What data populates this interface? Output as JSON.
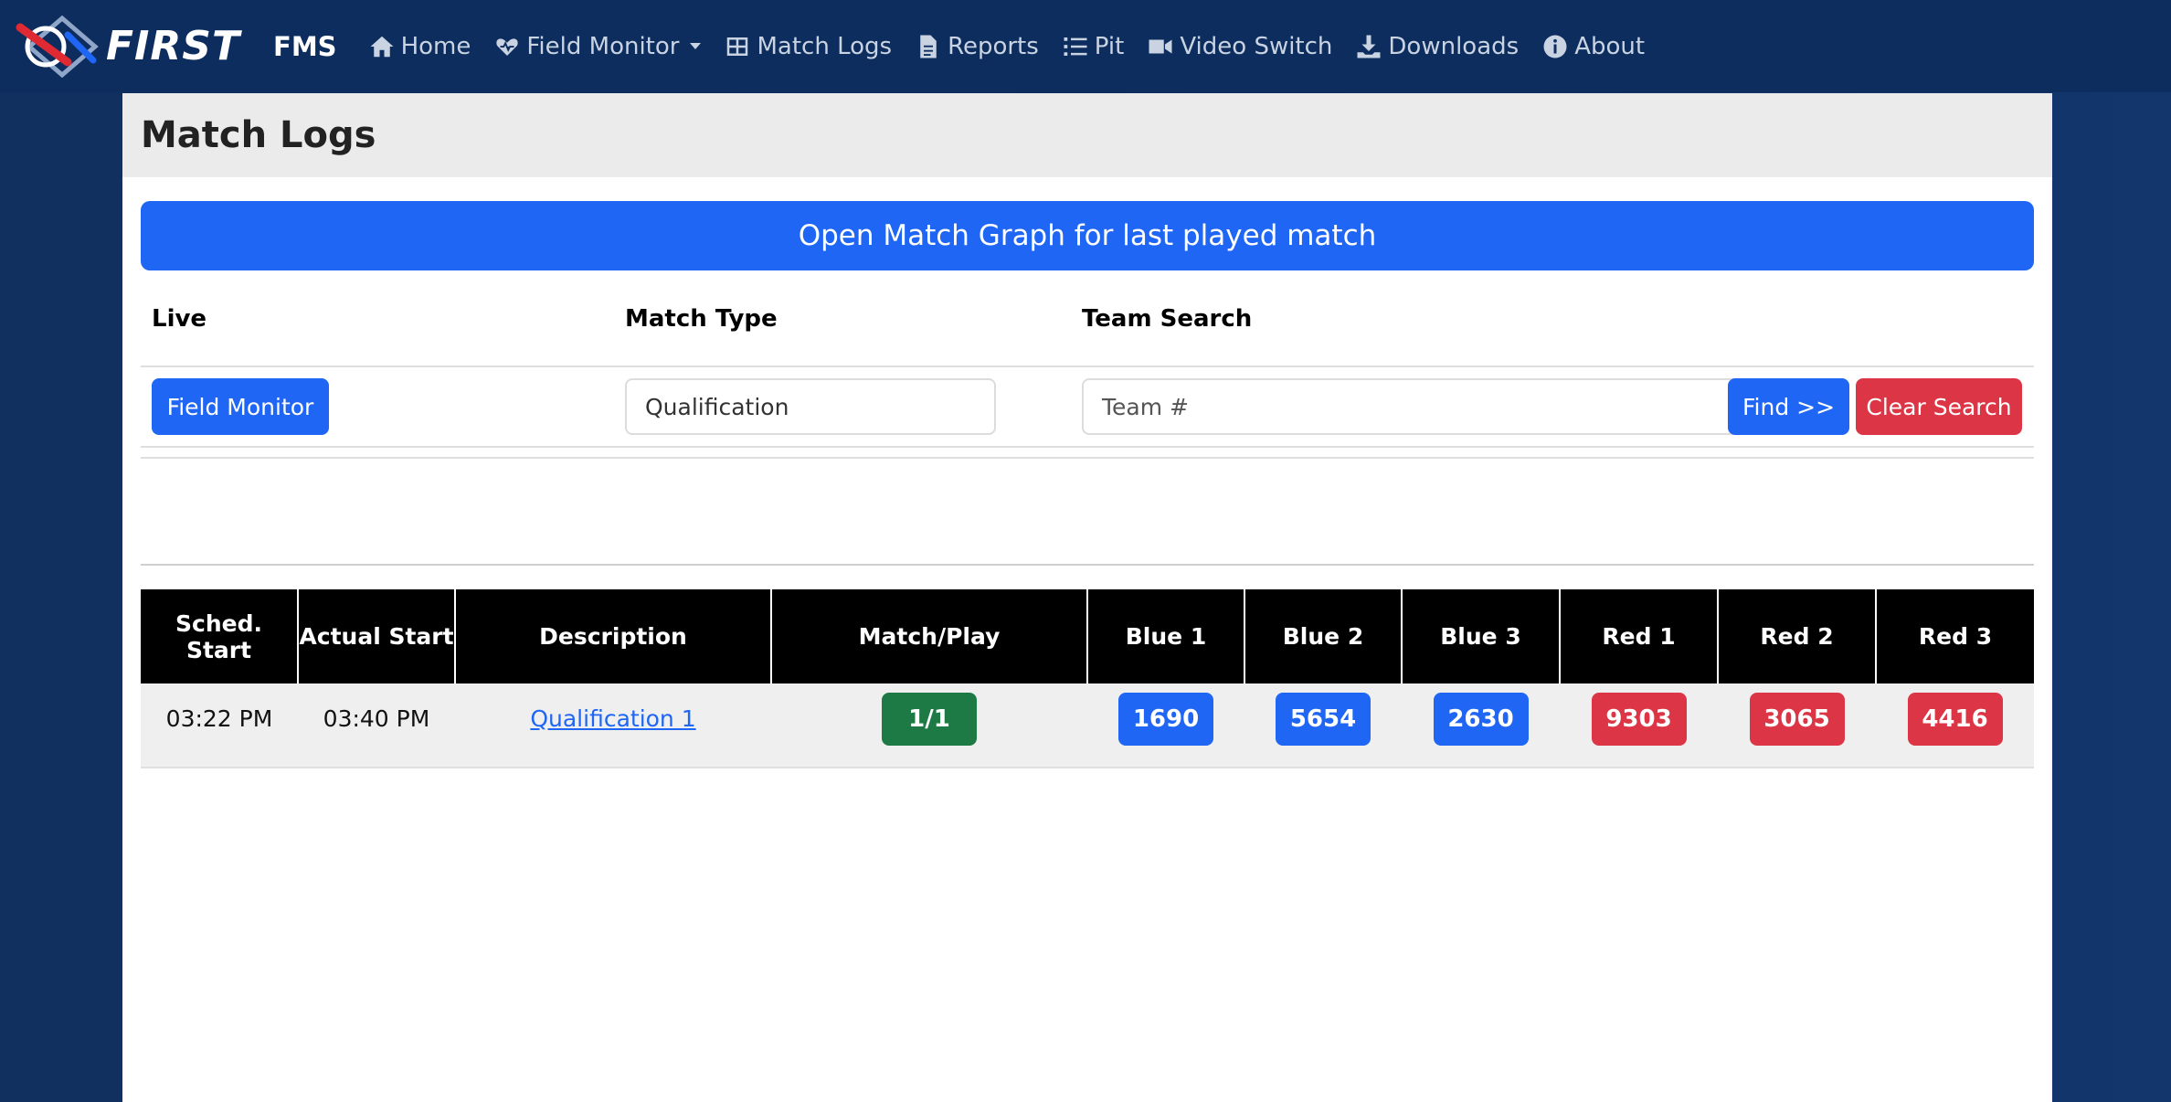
{
  "nav": {
    "brand": "FIRST",
    "app": "FMS",
    "items": [
      {
        "label": "Home",
        "icon": "home-icon"
      },
      {
        "label": "Field Monitor",
        "icon": "heartbeat-icon"
      },
      {
        "label": "Match Logs",
        "icon": "table-icon"
      },
      {
        "label": "Reports",
        "icon": "document-icon"
      },
      {
        "label": "Pit",
        "icon": "list-icon"
      },
      {
        "label": "Video Switch",
        "icon": "video-icon"
      },
      {
        "label": "Downloads",
        "icon": "download-icon"
      },
      {
        "label": "About",
        "icon": "info-icon"
      }
    ]
  },
  "page": {
    "title": "Match Logs",
    "graph_button": "Open Match Graph for last played match"
  },
  "filters": {
    "live_label": "Live",
    "field_monitor_button": "Field Monitor",
    "match_type_label": "Match Type",
    "match_type_value": "Qualification",
    "team_search_label": "Team Search",
    "team_search_placeholder": "Team #",
    "find_button": "Find >>",
    "clear_button": "Clear Search"
  },
  "table": {
    "headers": [
      "Sched. Start",
      "Actual Start",
      "Description",
      "Match/Play",
      "Blue 1",
      "Blue 2",
      "Blue 3",
      "Red 1",
      "Red 2",
      "Red 3"
    ],
    "rows": [
      {
        "sched_start": "03:22 PM",
        "actual_start": "03:40 PM",
        "description": "Qualification 1",
        "match_play": "1/1",
        "blue1": "1690",
        "blue2": "5654",
        "blue3": "2630",
        "red1": "9303",
        "red2": "3065",
        "red3": "4416"
      }
    ]
  },
  "colors": {
    "navbar": "#0c2d5d",
    "primary": "#1f66f4",
    "danger": "#dc3545",
    "success": "#1e7a45"
  }
}
